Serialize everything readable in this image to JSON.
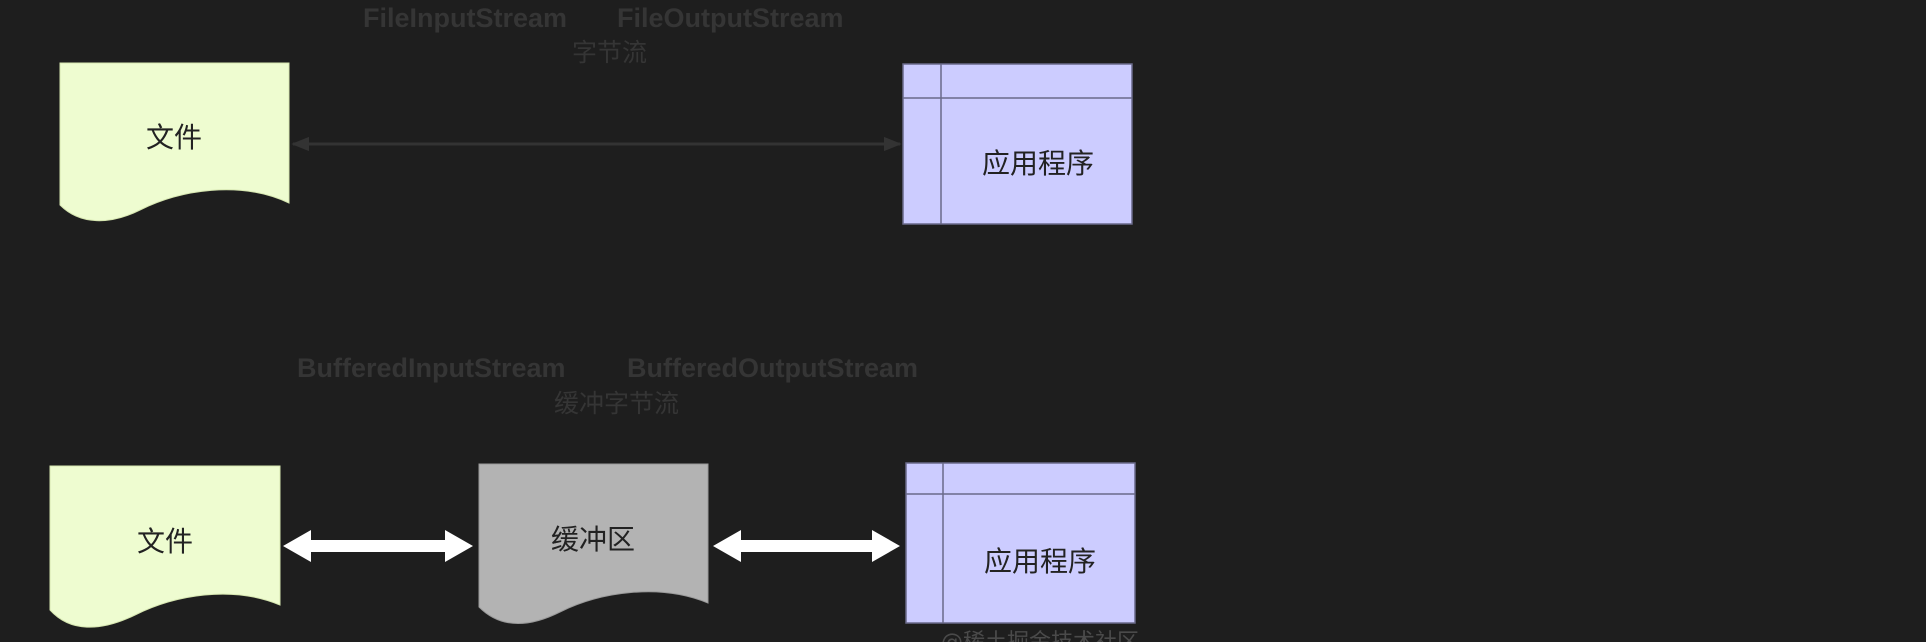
{
  "top_section": {
    "input_stream_label": "FileInputStream",
    "output_stream_label": "FileOutputStream",
    "stream_type_label": "字节流",
    "file_label": "文件",
    "app_label": "应用程序"
  },
  "bottom_section": {
    "input_stream_label": "BufferedInputStream",
    "output_stream_label": "BufferedOutputStream",
    "stream_type_label": "缓冲字节流",
    "file_label": "文件",
    "buffer_label": "缓冲区",
    "app_label": "应用程序"
  },
  "watermark": "@稀土掘金技术社区",
  "colors": {
    "background": "#1e1e1e",
    "file_fill": "#eefcd0",
    "app_fill": "#ccccff",
    "buffer_fill": "#b3b3b3",
    "arrow_top": "#333333",
    "arrow_bottom": "#ffffff"
  }
}
